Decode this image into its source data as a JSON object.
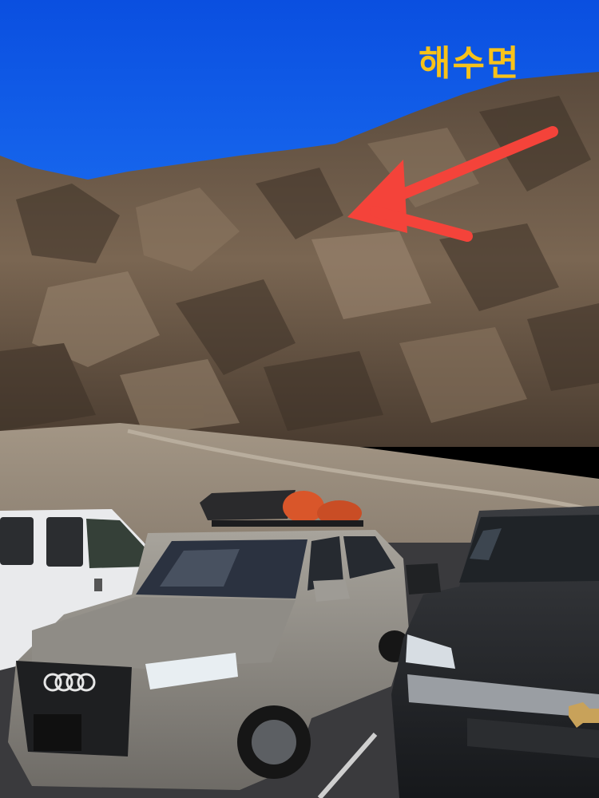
{
  "photo": {
    "annotation_text": "해수면",
    "annotation_color": "#f7c21a",
    "arrow_color": "#f4433a",
    "sky_color": "#0a55e6",
    "vehicles": [
      "white-pickup-truck",
      "silver-audi-suv",
      "dark-chevrolet-truck"
    ]
  }
}
